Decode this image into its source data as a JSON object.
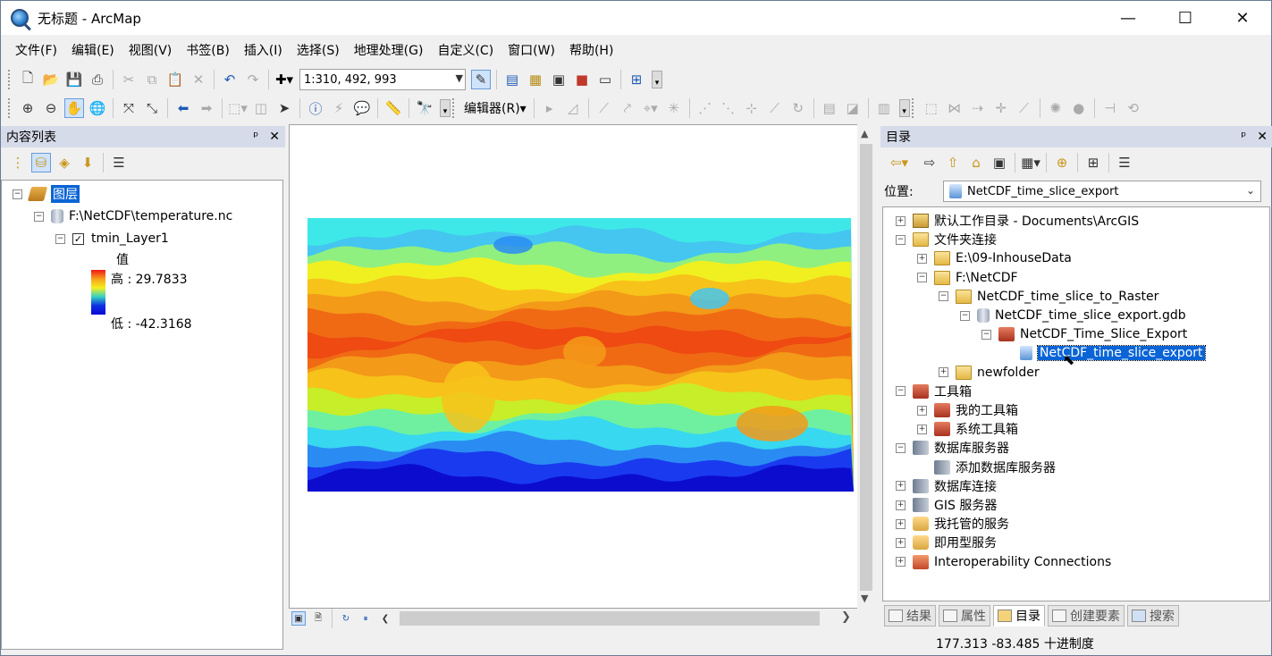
{
  "window": {
    "title": "无标题 - ArcMap",
    "minimize": "—",
    "maximize": "☐",
    "close": "✕"
  },
  "menu": [
    "文件(F)",
    "编辑(E)",
    "视图(V)",
    "书签(B)",
    "插入(I)",
    "选择(S)",
    "地理处理(G)",
    "自定义(C)",
    "窗口(W)",
    "帮助(H)"
  ],
  "toolbar": {
    "scale": "1:310, 492, 993",
    "editor_label": "编辑器(R)▾"
  },
  "toc": {
    "title": "内容列表",
    "pin": "ᵖ",
    "close": "✕",
    "layers_label": "图层",
    "source": "F:\\NetCDF\\temperature.nc",
    "layer_name": "tmin_Layer1",
    "legend_title": "值",
    "high_label": "高 : 29.7833",
    "low_label": "低 : -42.3168",
    "checked": "✓"
  },
  "catalog": {
    "title": "目录",
    "location_label": "位置:",
    "location_value": "NetCDF_time_slice_export",
    "tree": [
      {
        "label": "默认工作目录 - Documents\\ArcGIS",
        "exp": "+"
      },
      {
        "label": "文件夹连接",
        "exp": "−"
      },
      {
        "label": "E:\\09-InhouseData",
        "exp": "+"
      },
      {
        "label": "F:\\NetCDF",
        "exp": "−"
      },
      {
        "label": "NetCDF_time_slice_to_Raster",
        "exp": "−"
      },
      {
        "label": "NetCDF_time_slice_export.gdb",
        "exp": "−"
      },
      {
        "label": "NetCDF_Time_Slice_Export",
        "exp": "−"
      },
      {
        "label": "NetCDF_time_slice_export",
        "exp": ""
      },
      {
        "label": "newfolder",
        "exp": "+"
      },
      {
        "label": "工具箱",
        "exp": "−"
      },
      {
        "label": "我的工具箱",
        "exp": "+"
      },
      {
        "label": "系统工具箱",
        "exp": "+"
      },
      {
        "label": "数据库服务器",
        "exp": "−"
      },
      {
        "label": "添加数据库服务器",
        "exp": ""
      },
      {
        "label": "数据库连接",
        "exp": "+"
      },
      {
        "label": "GIS 服务器",
        "exp": "+"
      },
      {
        "label": "我托管的服务",
        "exp": "+"
      },
      {
        "label": "即用型服务",
        "exp": "+"
      },
      {
        "label": "Interoperability Connections",
        "exp": "+"
      }
    ],
    "tabs": [
      "结果",
      "属性",
      "目录",
      "创建要素",
      "搜索"
    ]
  },
  "status": {
    "coords": "177.313   -83.485 十进制度"
  },
  "map": {
    "bands": [
      "#3ee8e8",
      "#44c6f0",
      "#8ff080",
      "#f0f020",
      "#f7c21a",
      "#f39a18",
      "#f06a14",
      "#ee4a12",
      "#f06a14",
      "#f39a18",
      "#f7c21a",
      "#c7ee28",
      "#6ff0a0",
      "#38d8f0",
      "#2a8cf2",
      "#1a3af0",
      "#0c0ccf"
    ]
  }
}
